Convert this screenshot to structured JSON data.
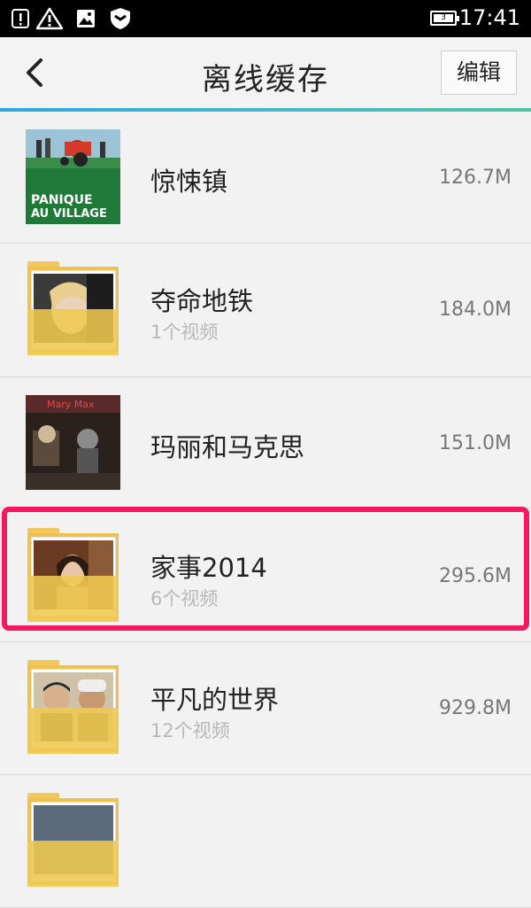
{
  "status_bar": {
    "time": "17:41",
    "battery_level": "3",
    "icons": [
      "alert-icon",
      "warning-icon",
      "image-icon",
      "shield-icon"
    ]
  },
  "header": {
    "title": "离线缓存",
    "edit_label": "编辑",
    "back_icon": "chevron-left-icon"
  },
  "colors": {
    "accent_gradient": [
      "#2ea6e0",
      "#52c3a0"
    ],
    "highlight": "#f5185f",
    "folder": "#f0c050"
  },
  "items": [
    {
      "name": "惊悚镇",
      "subtitle": "",
      "size": "126.7M",
      "type": "video"
    },
    {
      "name": "夺命地铁",
      "subtitle": "1个视频",
      "size": "184.0M",
      "type": "folder"
    },
    {
      "name": "玛丽和马克思",
      "subtitle": "",
      "size": "151.0M",
      "type": "video"
    },
    {
      "name": "家事2014",
      "subtitle": "6个视频",
      "size": "295.6M",
      "type": "folder"
    },
    {
      "name": "平凡的世界",
      "subtitle": "12个视频",
      "size": "929.8M",
      "type": "folder"
    },
    {
      "name": "",
      "subtitle": "",
      "size": "",
      "type": "folder"
    }
  ]
}
